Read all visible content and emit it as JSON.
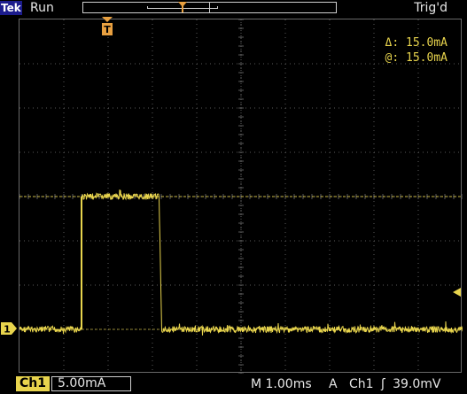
{
  "header": {
    "brand": "Tek",
    "run_state": "Run",
    "trigger_status": "Trig'd"
  },
  "trigger_marker": {
    "label": "T"
  },
  "cursor": {
    "delta_symbol": "Δ:",
    "delta_value": "15.0mA",
    "at_symbol": "@:",
    "at_value": "15.0mA"
  },
  "channel_marker": {
    "label": "1"
  },
  "footer": {
    "channel": "Ch1",
    "scale": "5.00mA",
    "timebase": "M 1.00ms",
    "trigger_mode": "A",
    "trigger_source": "Ch1",
    "trigger_slope": "ʃ",
    "trigger_level": "39.0mV"
  },
  "waveform": {
    "baseline_current": 0,
    "pulse_current": 15,
    "pulse_start_div": 1.4,
    "pulse_end_div": 3.15,
    "noise": "high-frequency noise visible on both levels",
    "cursor_level": 15,
    "channel_color": "#e8d44d"
  },
  "colors": {
    "background": "#000000",
    "trace": "#e8d44d",
    "graticule": "#5a5a5a",
    "brand_bg": "#1c1c8c"
  }
}
